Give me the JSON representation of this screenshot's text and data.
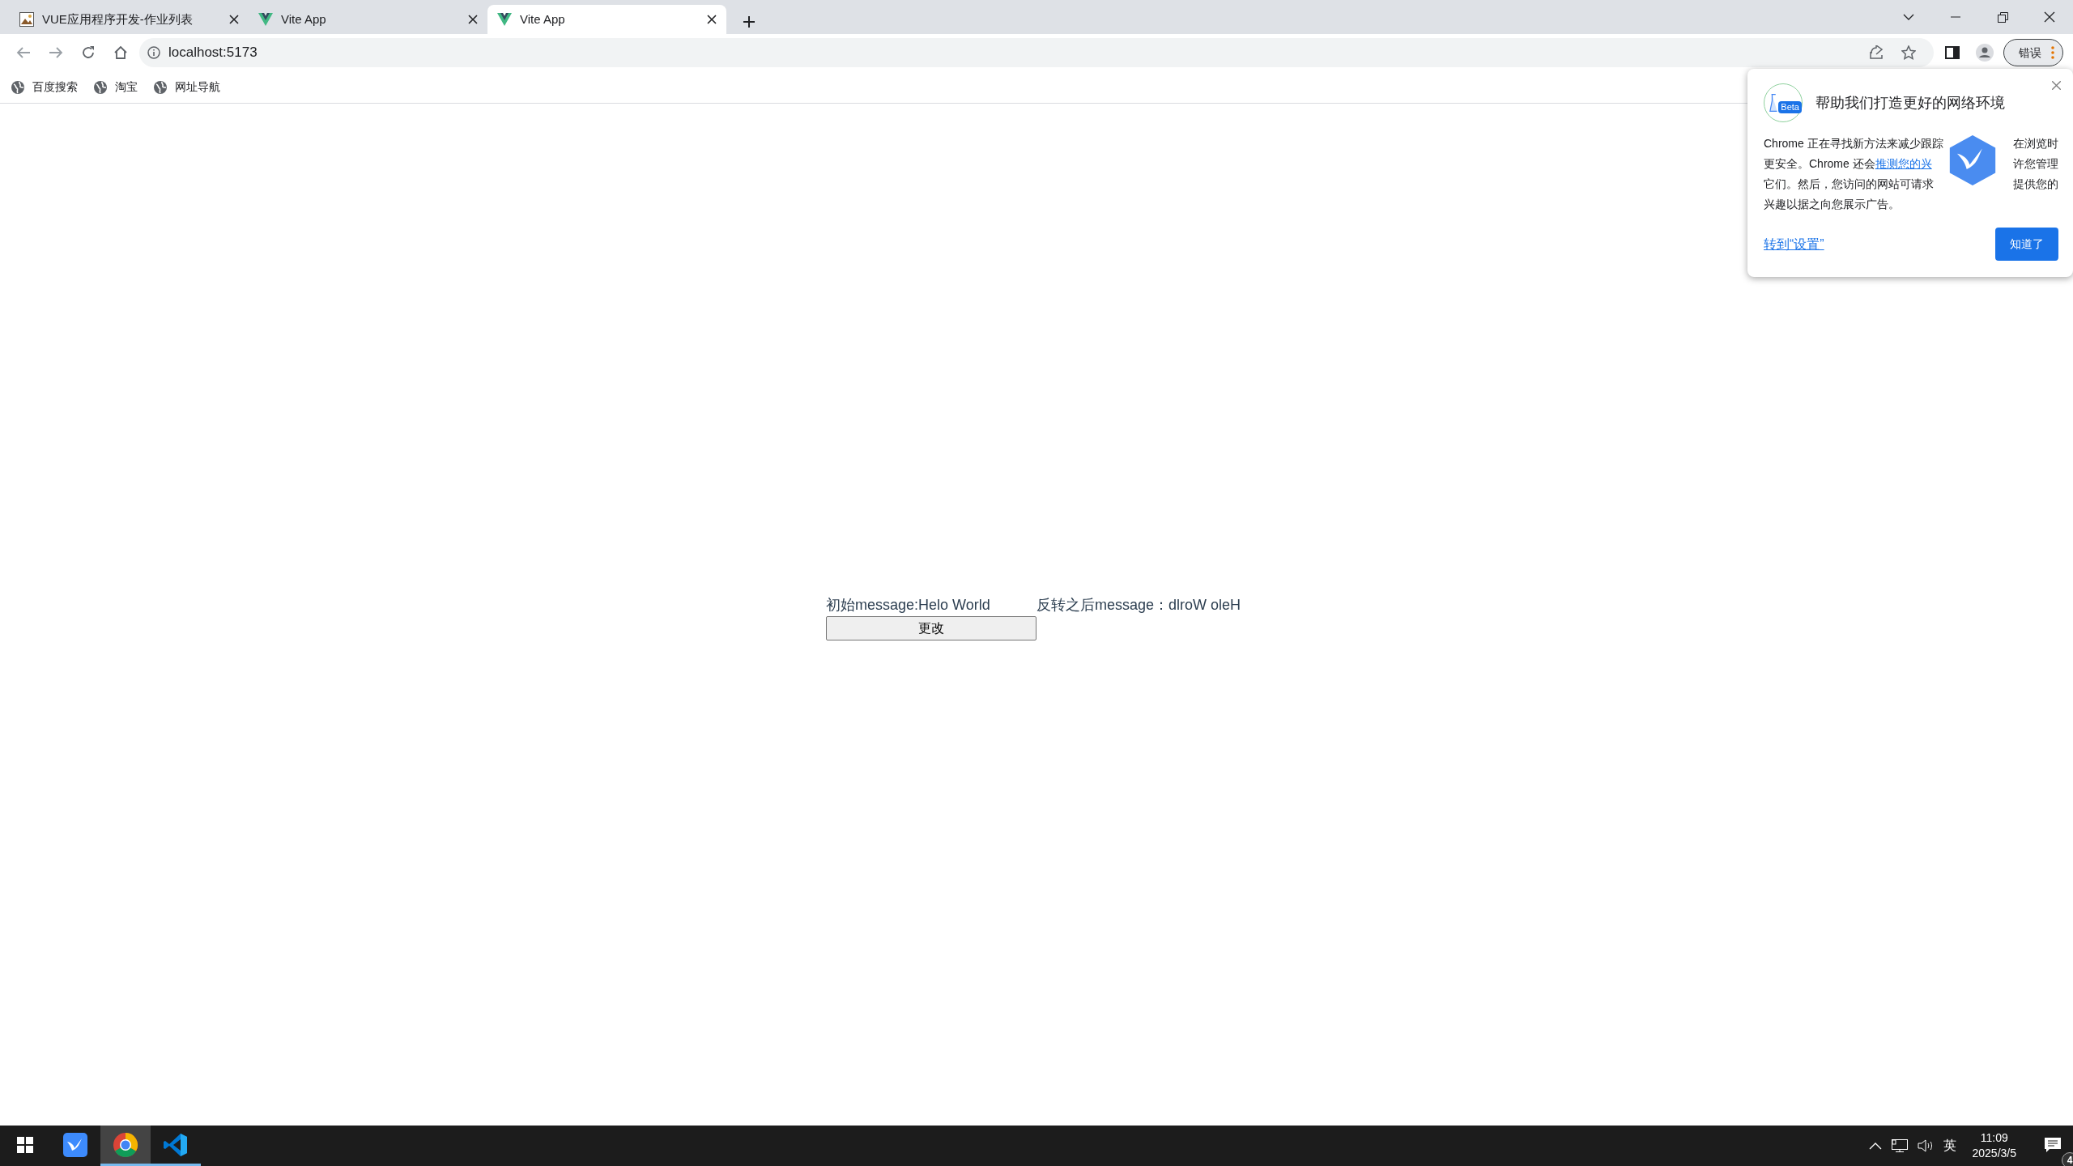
{
  "browser": {
    "tabs": [
      {
        "title": "VUE应用程序开发-作业列表",
        "selected": false
      },
      {
        "title": "Vite App",
        "selected": false
      },
      {
        "title": "Vite App",
        "selected": true
      }
    ],
    "address": "localhost:5173",
    "profile_button": "错误",
    "bookmarks": [
      "百度搜索",
      "淘宝",
      "网址导航"
    ]
  },
  "page": {
    "original_label": "初始message:Helo World",
    "reversed_label": "反转之后message：dlroW oleH",
    "button": "更改"
  },
  "popup": {
    "title": "帮助我们打造更好的网络环境",
    "badge": "Beta",
    "lines": [
      [
        {
          "kind": "text",
          "text": "Chrome 正在寻找新方法来减少跟踪"
        },
        {
          "kind": "text",
          "text": "在浏览时"
        }
      ],
      [
        {
          "kind": "text",
          "text": "更安全。Chrome 还会"
        },
        {
          "kind": "link",
          "text": "推测您的兴"
        },
        {
          "kind": "text",
          "text": "许您管理"
        }
      ],
      [
        {
          "kind": "text",
          "text": "它们。然后，您访问的网站可请求"
        },
        {
          "kind": "text",
          "text": "提供您的"
        }
      ],
      [
        {
          "kind": "text",
          "text": "兴趣以据之向您展示广告。"
        }
      ]
    ],
    "link": "转到“设置”",
    "button": "知道了"
  },
  "taskbar": {
    "apps": [
      {
        "kind": "xunlei",
        "selected": false,
        "running": false
      },
      {
        "kind": "chrome",
        "selected": true,
        "running": true
      },
      {
        "kind": "vscode",
        "selected": false,
        "running": true
      }
    ],
    "ime": "英",
    "time": "11:09",
    "date": "2025/3/5",
    "notifications": "4"
  }
}
